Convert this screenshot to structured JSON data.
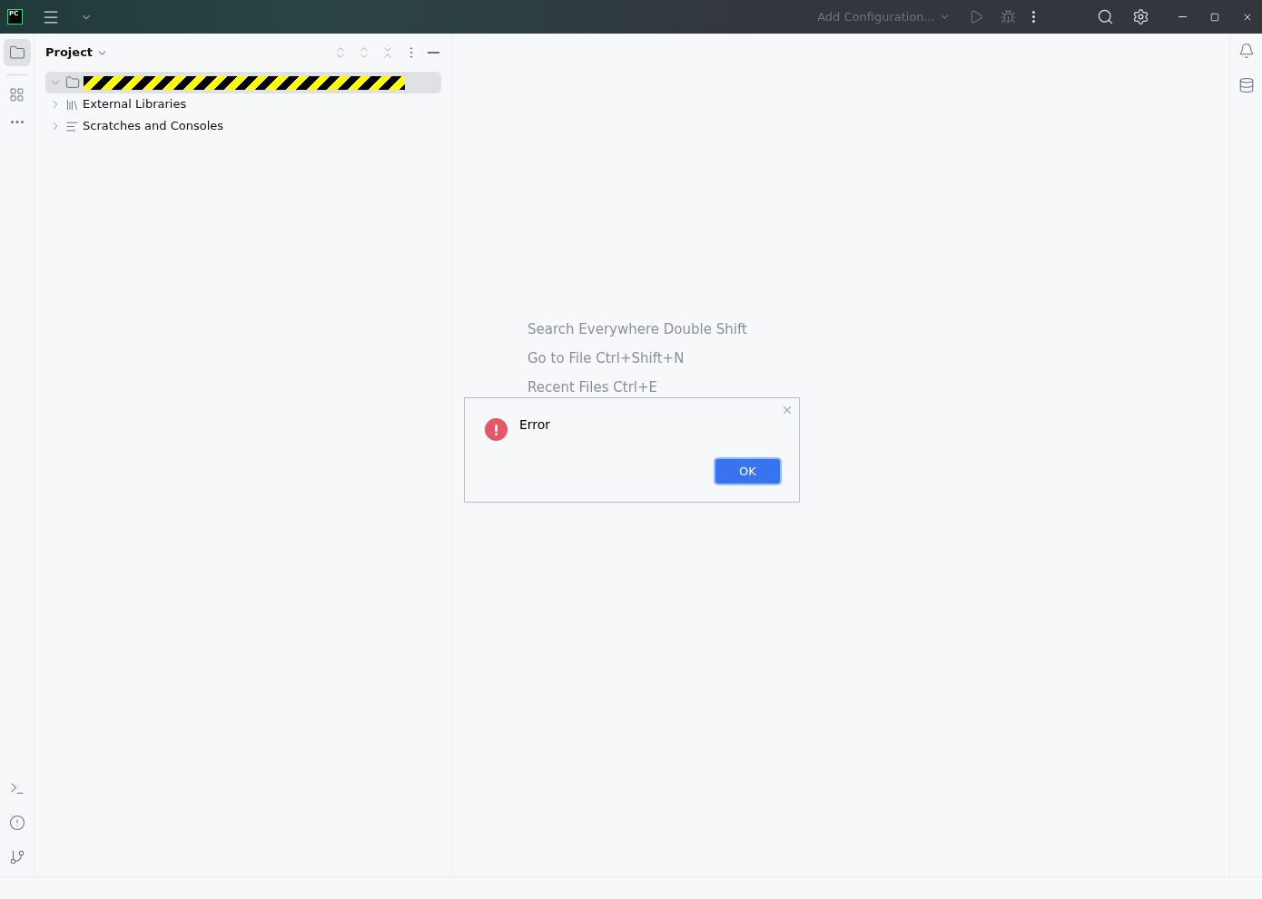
{
  "title_bar": {
    "logo": "PC",
    "run_config": "Add Configuration..."
  },
  "project_panel": {
    "title": "Project",
    "tree": [
      {
        "kind": "redacted",
        "expanded": true,
        "selected": true
      },
      {
        "kind": "libraries",
        "label": "External Libraries",
        "expanded": false,
        "selected": false
      },
      {
        "kind": "scratches",
        "label": "Scratches and Consoles",
        "expanded": false,
        "selected": false
      }
    ]
  },
  "editor_hints": [
    "Search Everywhere Double Shift",
    "Go to File Ctrl+Shift+N",
    "Recent Files Ctrl+E"
  ],
  "dialog": {
    "message": "Error",
    "buttons": [
      "OK"
    ]
  }
}
